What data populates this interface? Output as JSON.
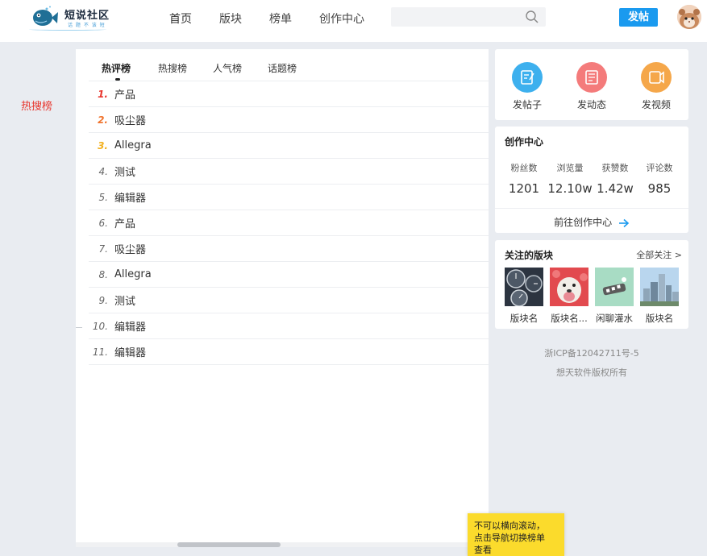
{
  "header": {
    "logo_title": "短说社区",
    "logo_subtitle": "话 题 不 该 短",
    "nav": [
      "首页",
      "版块",
      "榜单",
      "创作中心"
    ],
    "search_placeholder": "",
    "post_button": "发帖"
  },
  "side_label": "热搜榜",
  "tabs": [
    "热评榜",
    "热搜榜",
    "人气榜",
    "话题榜"
  ],
  "active_tab": "热评榜",
  "hot_list": [
    {
      "rank": "1.",
      "text": "产品"
    },
    {
      "rank": "2.",
      "text": "吸尘器"
    },
    {
      "rank": "3.",
      "text": "Allegra"
    },
    {
      "rank": "4.",
      "text": "测试"
    },
    {
      "rank": "5.",
      "text": "编辑器"
    },
    {
      "rank": "6.",
      "text": "产品"
    },
    {
      "rank": "7.",
      "text": "吸尘器"
    },
    {
      "rank": "8.",
      "text": "Allegra"
    },
    {
      "rank": "9.",
      "text": "测试"
    },
    {
      "rank": "10.",
      "text": "编辑器"
    },
    {
      "rank": "11.",
      "text": "编辑器"
    }
  ],
  "tip": {
    "line1": "不可以横向滚动，",
    "line2": "点击导航切换榜单",
    "line3": "查看"
  },
  "actions": [
    {
      "label": "发帖子",
      "icon": "post-icon",
      "color": "#3db0ee"
    },
    {
      "label": "发动态",
      "icon": "dynamic-icon",
      "color": "#f47b7b"
    },
    {
      "label": "发视频",
      "icon": "video-icon",
      "color": "#f5a74a"
    }
  ],
  "creation_center": {
    "title": "创作中心",
    "stats": [
      {
        "label": "粉丝数",
        "value": "1201"
      },
      {
        "label": "浏览量",
        "value": "12.10w"
      },
      {
        "label": "获赞数",
        "value": "1.42w"
      },
      {
        "label": "评论数",
        "value": "985"
      }
    ],
    "goto_label": "前往创作中心"
  },
  "followed": {
    "title": "关注的版块",
    "all_label": "全部关注 >",
    "blocks": [
      {
        "name": "版块名",
        "image": "clocks-image"
      },
      {
        "name": "版块名...",
        "image": "dog-image"
      },
      {
        "name": "闲聊灌水",
        "image": "sticker-image"
      },
      {
        "name": "版块名",
        "image": "city-image"
      }
    ]
  },
  "footer": {
    "icp": "浙ICP备12042711号-5",
    "copyright": "想天软件版权所有"
  },
  "colors": {
    "accent": "#1a9aef",
    "rank1": "#e8352d",
    "rank2": "#f0742e",
    "rank3": "#f2b120",
    "tip_bg": "#fbdb2c"
  }
}
